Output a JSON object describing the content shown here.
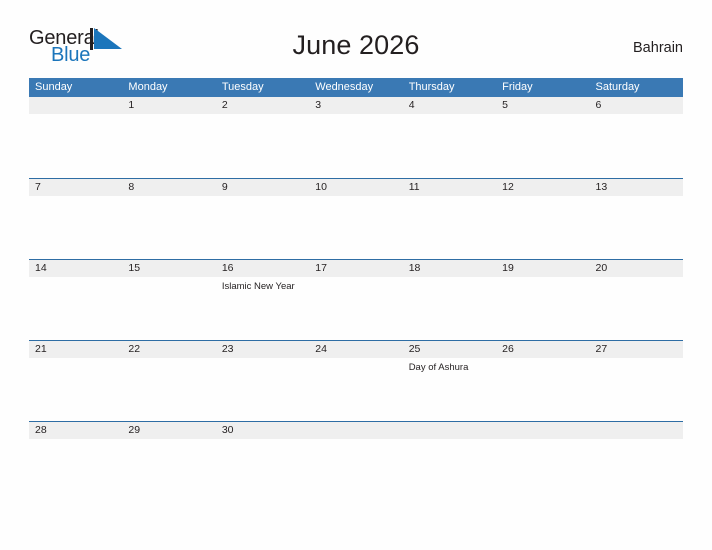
{
  "brand": {
    "name_top": "General",
    "name_bottom": "Blue",
    "top_color": "#231f20",
    "bottom_color": "#1b75bb"
  },
  "header": {
    "title": "June 2026",
    "country": "Bahrain"
  },
  "theme": {
    "header_bar_color": "#3a79b4",
    "row_border_color": "#2e6da4",
    "date_band_color": "#efefef",
    "text_color": "#231f20",
    "page_background": "#fefefe"
  },
  "weekdays": [
    "Sunday",
    "Monday",
    "Tuesday",
    "Wednesday",
    "Thursday",
    "Friday",
    "Saturday"
  ],
  "weeks": [
    {
      "days": [
        {
          "date": "",
          "event": ""
        },
        {
          "date": "1",
          "event": ""
        },
        {
          "date": "2",
          "event": ""
        },
        {
          "date": "3",
          "event": ""
        },
        {
          "date": "4",
          "event": ""
        },
        {
          "date": "5",
          "event": ""
        },
        {
          "date": "6",
          "event": ""
        }
      ]
    },
    {
      "days": [
        {
          "date": "7",
          "event": ""
        },
        {
          "date": "8",
          "event": ""
        },
        {
          "date": "9",
          "event": ""
        },
        {
          "date": "10",
          "event": ""
        },
        {
          "date": "11",
          "event": ""
        },
        {
          "date": "12",
          "event": ""
        },
        {
          "date": "13",
          "event": ""
        }
      ]
    },
    {
      "days": [
        {
          "date": "14",
          "event": ""
        },
        {
          "date": "15",
          "event": ""
        },
        {
          "date": "16",
          "event": "Islamic New Year"
        },
        {
          "date": "17",
          "event": ""
        },
        {
          "date": "18",
          "event": ""
        },
        {
          "date": "19",
          "event": ""
        },
        {
          "date": "20",
          "event": ""
        }
      ]
    },
    {
      "days": [
        {
          "date": "21",
          "event": ""
        },
        {
          "date": "22",
          "event": ""
        },
        {
          "date": "23",
          "event": ""
        },
        {
          "date": "24",
          "event": ""
        },
        {
          "date": "25",
          "event": "Day of Ashura"
        },
        {
          "date": "26",
          "event": ""
        },
        {
          "date": "27",
          "event": ""
        }
      ]
    },
    {
      "days": [
        {
          "date": "28",
          "event": ""
        },
        {
          "date": "29",
          "event": ""
        },
        {
          "date": "30",
          "event": ""
        },
        {
          "date": "",
          "event": ""
        },
        {
          "date": "",
          "event": ""
        },
        {
          "date": "",
          "event": ""
        },
        {
          "date": "",
          "event": ""
        }
      ]
    }
  ]
}
